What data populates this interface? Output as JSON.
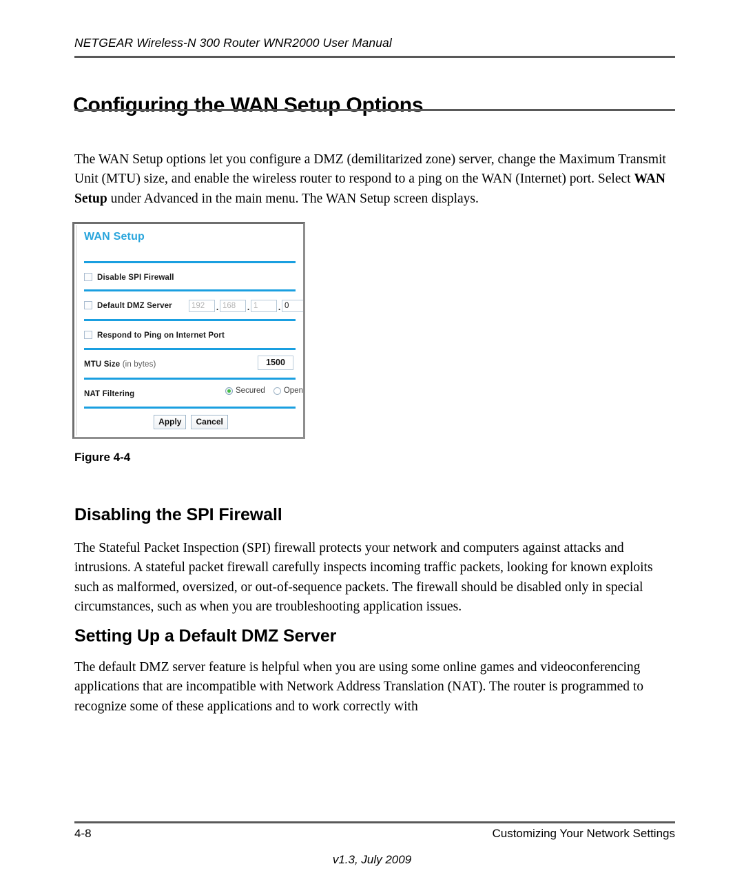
{
  "header": {
    "running_head": "NETGEAR Wireless-N 300 Router WNR2000 User Manual"
  },
  "title": "Configuring the WAN Setup Options",
  "paragraphs": {
    "intro_part1": "The WAN Setup options let you configure a DMZ (demilitarized zone) server, change the Maximum Transmit Unit (MTU) size, and enable the wireless router to respond to a ping on the WAN (Internet) port. Select ",
    "intro_bold": "WAN Setup",
    "intro_part2": " under Advanced in the main menu. The WAN Setup screen displays.",
    "spi": "The Stateful Packet Inspection (SPI) firewall protects your network and computers against attacks and intrusions. A stateful packet firewall carefully inspects incoming traffic packets, looking for known exploits such as malformed, oversized, or out-of-sequence packets. The firewall should be disabled only in special circumstances, such as when you are troubleshooting application issues.",
    "dmz": "The default DMZ server feature is helpful when you are using some online games and videoconferencing applications that are incompatible with Network Address Translation (NAT). The router is programmed to recognize some of these applications and to work correctly with"
  },
  "headings": {
    "spi": "Disabling the SPI Firewall",
    "dmz": "Setting Up a Default DMZ Server"
  },
  "figure": {
    "caption": "Figure 4-4",
    "panel_title": "WAN Setup",
    "rows": {
      "disable_spi_label": "Disable SPI Firewall",
      "default_dmz_label": "Default DMZ Server",
      "respond_ping_label": "Respond to Ping on Internet Port",
      "mtu_label": "MTU Size",
      "mtu_label_unit": "(in bytes)",
      "nat_label": "NAT Filtering"
    },
    "dmz_ip": {
      "octet1": "192",
      "octet2": "168",
      "octet3": "1",
      "octet4": "0",
      "separator": "."
    },
    "mtu_value": "1500",
    "nat_options": [
      {
        "label": "Secured",
        "selected": true
      },
      {
        "label": "Open",
        "selected": false
      }
    ],
    "nat_option_secured": "Secured",
    "nat_option_open": "Open",
    "buttons": {
      "apply": "Apply",
      "cancel": "Cancel"
    },
    "colors": {
      "panel_title": "#29a5dc",
      "separator": "#1a9fe0",
      "radio_selected": "#43bb43",
      "frame": "#6e6e6e"
    }
  },
  "footer": {
    "page_number": "4-8",
    "chapter": "Customizing Your Network Settings",
    "version": "v1.3, July 2009"
  }
}
